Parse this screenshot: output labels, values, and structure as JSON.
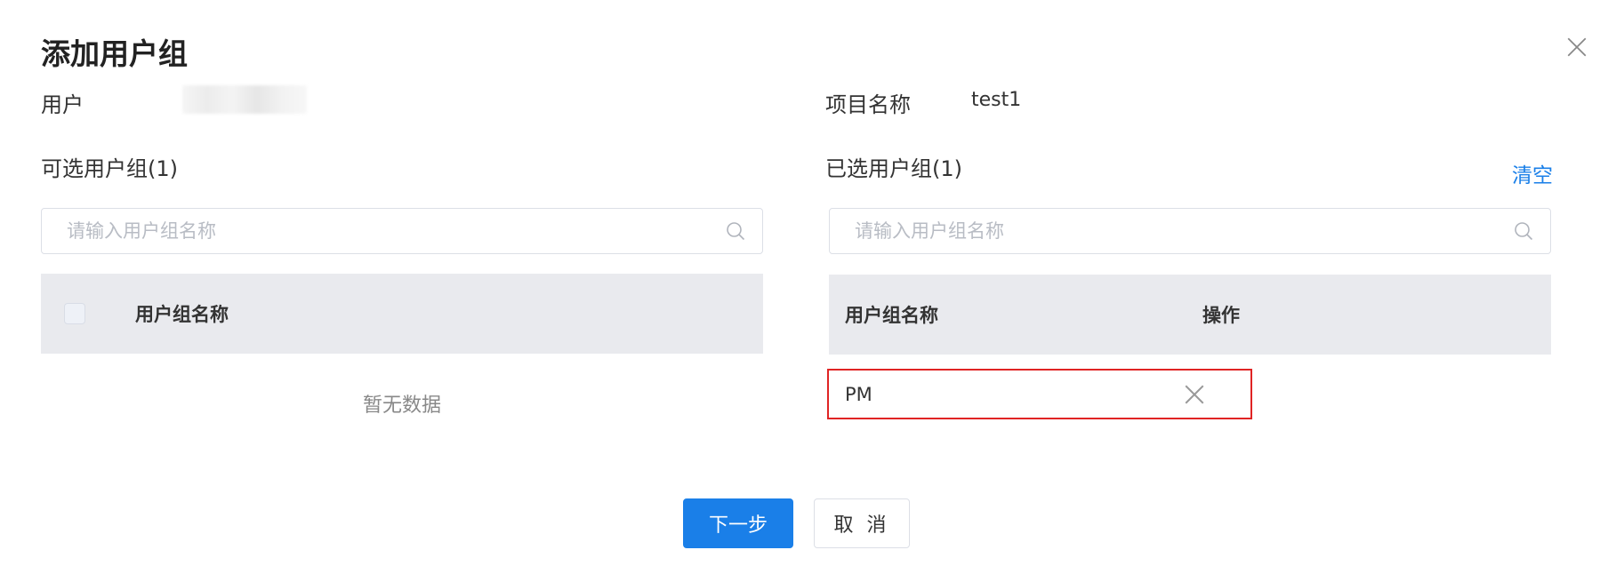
{
  "dialog": {
    "title": "添加用户组"
  },
  "form": {
    "user_label": "用户",
    "project_label": "项目名称",
    "project_value": "test1"
  },
  "left_panel": {
    "heading": "可选用户组(1)",
    "search_placeholder": "请输入用户组名称",
    "column_name": "用户组名称",
    "empty_text": "暂无数据"
  },
  "right_panel": {
    "heading": "已选用户组(1)",
    "clear_label": "清空",
    "search_placeholder": "请输入用户组名称",
    "column_name": "用户组名称",
    "column_action": "操作",
    "rows": [
      {
        "name": "PM"
      }
    ]
  },
  "footer": {
    "next_label": "下一步",
    "cancel_label": "取 消"
  },
  "colors": {
    "primary": "#1a7fe8",
    "highlight_border": "#e02424",
    "table_header_bg": "#e9eaee"
  },
  "icons": {
    "close": "close-icon",
    "search": "search-icon",
    "remove": "remove-icon"
  }
}
